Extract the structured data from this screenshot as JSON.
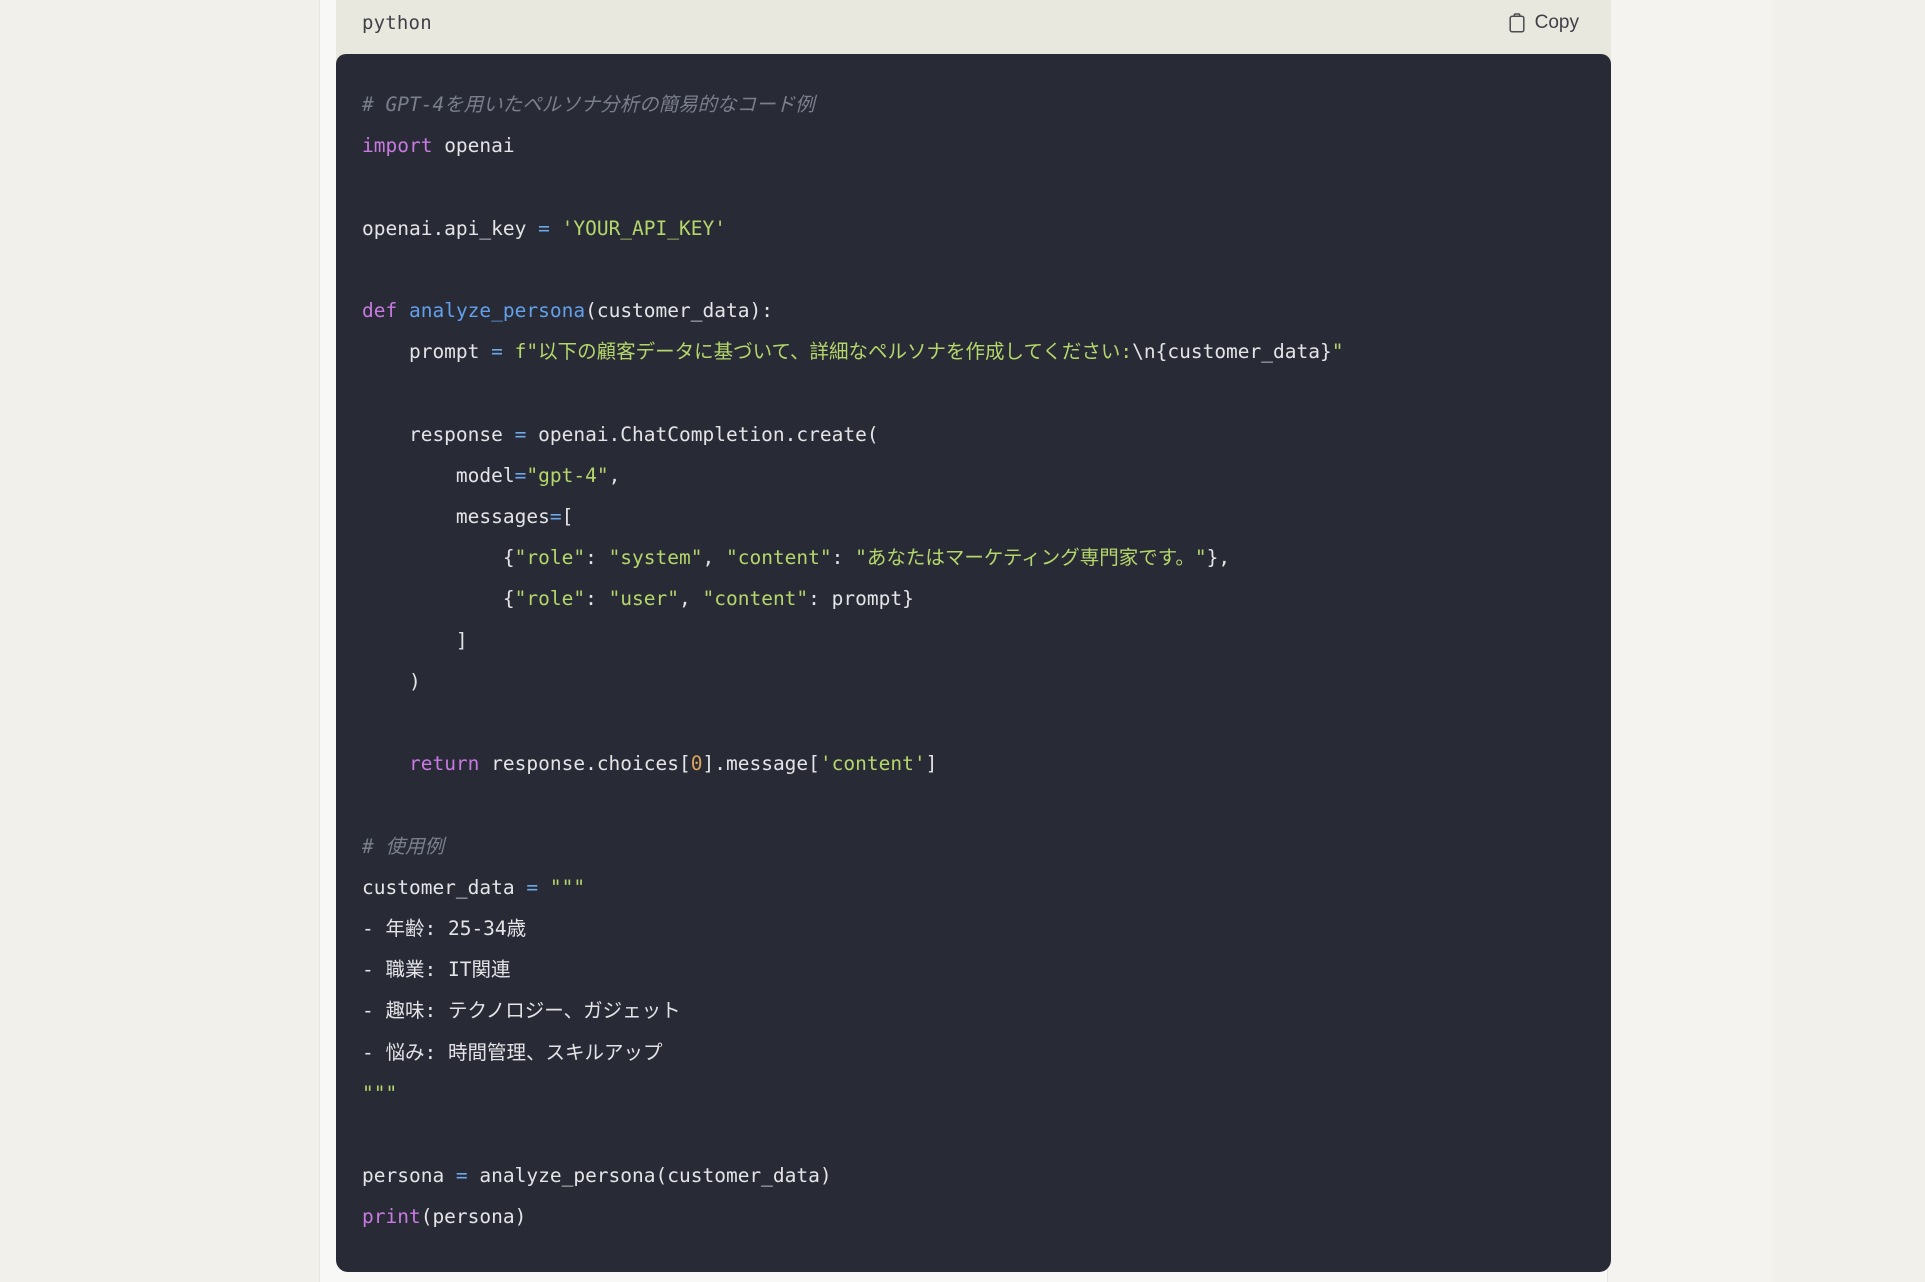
{
  "card": {
    "language_label": "python",
    "copy_label": "Copy",
    "copy_icon": "clipboard-icon"
  },
  "theme": {
    "page_background": "#f0efe8",
    "content_background": "#f8f8f6",
    "card_header_background": "#e9e8df",
    "code_background": "#282a36",
    "code_text": "#e4e4e7",
    "comment": "#7a7f8c",
    "keyword": "#c77ae0",
    "function": "#62a0ea",
    "string": "#b5d66a",
    "operator": "#6ea8e8",
    "number": "#d9a45b"
  },
  "code": {
    "language": "python",
    "lines": [
      "# GPT-4を用いたペルソナ分析の簡易的なコード例",
      "import openai",
      "",
      "openai.api_key = 'YOUR_API_KEY'",
      "",
      "def analyze_persona(customer_data):",
      "    prompt = f\"以下の顧客データに基づいて、詳細なペルソナを作成してください:\\n{customer_data}\"",
      "",
      "    response = openai.ChatCompletion.create(",
      "        model=\"gpt-4\",",
      "        messages=[",
      "            {\"role\": \"system\", \"content\": \"あなたはマーケティング専門家です。\"},",
      "            {\"role\": \"user\", \"content\": prompt}",
      "        ]",
      "    )",
      "",
      "    return response.choices[0].message['content']",
      "",
      "# 使用例",
      "customer_data = \"\"\"",
      "- 年齢: 25-34歳",
      "- 職業: IT関連",
      "- 趣味: テクノロジー、ガジェット",
      "- 悩み: 時間管理、スキルアップ",
      "\"\"\"",
      "",
      "persona = analyze_persona(customer_data)",
      "print(persona)"
    ],
    "tokens": [
      [
        {
          "t": "comment",
          "v": "# GPT-4を用いたペルソナ分析の簡易的なコード例"
        }
      ],
      [
        {
          "t": "kw",
          "v": "import"
        },
        {
          "t": "plain",
          "v": " openai"
        }
      ],
      [],
      [
        {
          "t": "plain",
          "v": "openai.api_key "
        },
        {
          "t": "op",
          "v": "="
        },
        {
          "t": "plain",
          "v": " "
        },
        {
          "t": "str",
          "v": "'YOUR_API_KEY'"
        }
      ],
      [],
      [
        {
          "t": "kw",
          "v": "def"
        },
        {
          "t": "plain",
          "v": " "
        },
        {
          "t": "fn",
          "v": "analyze_persona"
        },
        {
          "t": "plain",
          "v": "(customer_data):"
        }
      ],
      [
        {
          "t": "plain",
          "v": "    prompt "
        },
        {
          "t": "op",
          "v": "="
        },
        {
          "t": "plain",
          "v": " "
        },
        {
          "t": "str",
          "v": "f\"以下の顧客データに基づいて、詳細なペルソナを作成してください:"
        },
        {
          "t": "interp",
          "v": "\\n{customer_data}"
        },
        {
          "t": "str",
          "v": "\""
        }
      ],
      [],
      [
        {
          "t": "plain",
          "v": "    response "
        },
        {
          "t": "op",
          "v": "="
        },
        {
          "t": "plain",
          "v": " openai.ChatCompletion.create("
        }
      ],
      [
        {
          "t": "plain",
          "v": "        model"
        },
        {
          "t": "op",
          "v": "="
        },
        {
          "t": "str",
          "v": "\"gpt-4\""
        },
        {
          "t": "plain",
          "v": ","
        }
      ],
      [
        {
          "t": "plain",
          "v": "        messages"
        },
        {
          "t": "op",
          "v": "="
        },
        {
          "t": "plain",
          "v": "["
        }
      ],
      [
        {
          "t": "plain",
          "v": "            {"
        },
        {
          "t": "str",
          "v": "\"role\""
        },
        {
          "t": "plain",
          "v": ": "
        },
        {
          "t": "str",
          "v": "\"system\""
        },
        {
          "t": "plain",
          "v": ", "
        },
        {
          "t": "str",
          "v": "\"content\""
        },
        {
          "t": "plain",
          "v": ": "
        },
        {
          "t": "str",
          "v": "\"あなたはマーケティング専門家です。\""
        },
        {
          "t": "plain",
          "v": "},"
        }
      ],
      [
        {
          "t": "plain",
          "v": "            {"
        },
        {
          "t": "str",
          "v": "\"role\""
        },
        {
          "t": "plain",
          "v": ": "
        },
        {
          "t": "str",
          "v": "\"user\""
        },
        {
          "t": "plain",
          "v": ", "
        },
        {
          "t": "str",
          "v": "\"content\""
        },
        {
          "t": "plain",
          "v": ": prompt}"
        }
      ],
      [
        {
          "t": "plain",
          "v": "        ]"
        }
      ],
      [
        {
          "t": "plain",
          "v": "    )"
        }
      ],
      [],
      [
        {
          "t": "plain",
          "v": "    "
        },
        {
          "t": "kw",
          "v": "return"
        },
        {
          "t": "plain",
          "v": " response.choices["
        },
        {
          "t": "num",
          "v": "0"
        },
        {
          "t": "plain",
          "v": "].message["
        },
        {
          "t": "str",
          "v": "'content'"
        },
        {
          "t": "plain",
          "v": "]"
        }
      ],
      [],
      [
        {
          "t": "comment",
          "v": "# 使用例"
        }
      ],
      [
        {
          "t": "plain",
          "v": "customer_data "
        },
        {
          "t": "op",
          "v": "="
        },
        {
          "t": "plain",
          "v": " "
        },
        {
          "t": "str",
          "v": "\"\"\""
        }
      ],
      [
        {
          "t": "plain",
          "v": "- 年齢: 25-34歳"
        }
      ],
      [
        {
          "t": "plain",
          "v": "- 職業: IT関連"
        }
      ],
      [
        {
          "t": "plain",
          "v": "- 趣味: テクノロジー、ガジェット"
        }
      ],
      [
        {
          "t": "plain",
          "v": "- 悩み: 時間管理、スキルアップ"
        }
      ],
      [
        {
          "t": "str",
          "v": "\"\"\""
        }
      ],
      [],
      [
        {
          "t": "plain",
          "v": "persona "
        },
        {
          "t": "op",
          "v": "="
        },
        {
          "t": "plain",
          "v": " analyze_persona(customer_data)"
        }
      ],
      [
        {
          "t": "kw",
          "v": "print"
        },
        {
          "t": "plain",
          "v": "(persona)"
        }
      ]
    ]
  }
}
